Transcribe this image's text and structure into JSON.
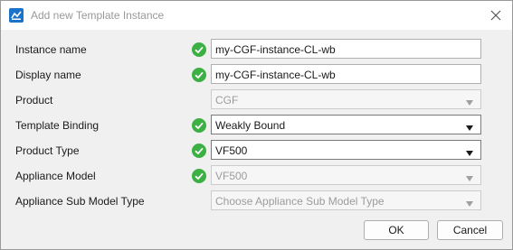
{
  "window": {
    "title": "Add new Template Instance",
    "app_icon": "app-icon",
    "close_icon": "close-icon"
  },
  "form": {
    "fields": [
      {
        "label": "Instance name",
        "value": "my-CGF-instance-CL-wb",
        "kind": "text",
        "valid": true,
        "enabled": true
      },
      {
        "label": "Display name",
        "value": "my-CGF-instance-CL-wb",
        "kind": "text",
        "valid": true,
        "enabled": true
      },
      {
        "label": "Product",
        "value": "CGF",
        "kind": "dropdown",
        "valid": false,
        "enabled": false
      },
      {
        "label": "Template Binding",
        "value": "Weakly Bound",
        "kind": "dropdown",
        "valid": true,
        "enabled": true
      },
      {
        "label": "Product Type",
        "value": "VF500",
        "kind": "dropdown",
        "valid": true,
        "enabled": true
      },
      {
        "label": "Appliance Model",
        "value": "VF500",
        "kind": "dropdown",
        "valid": true,
        "enabled": false
      },
      {
        "label": "Appliance Sub Model Type",
        "placeholder": "Choose Appliance Sub Model Type",
        "kind": "dropdown",
        "valid": false,
        "enabled": false
      }
    ]
  },
  "buttons": {
    "ok": "OK",
    "cancel": "Cancel"
  },
  "colors": {
    "valid_check": "#3cb043",
    "accent": "#1a73c9"
  }
}
